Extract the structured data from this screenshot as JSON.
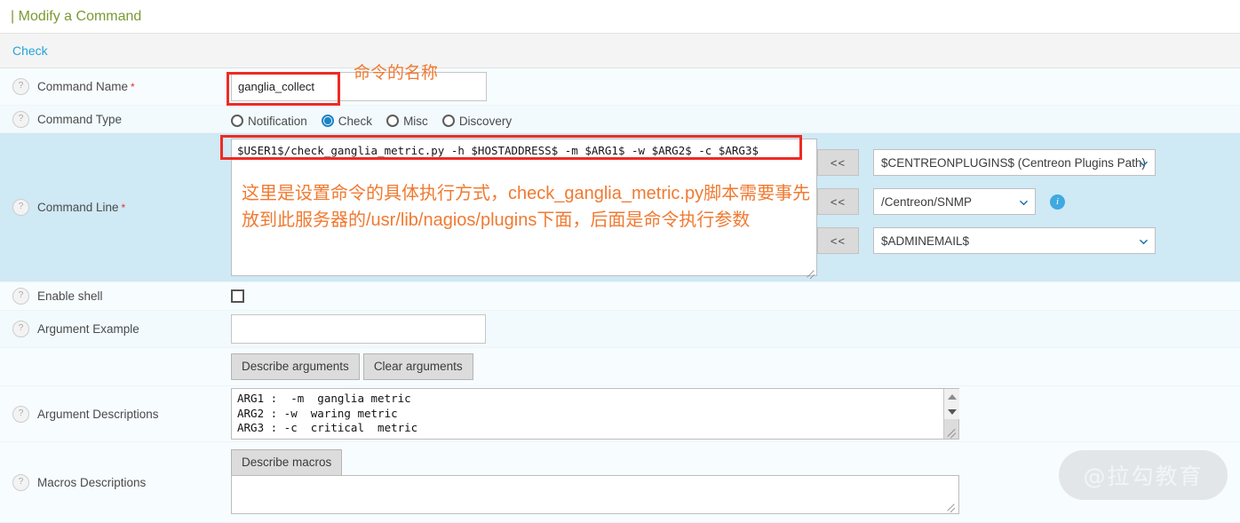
{
  "page": {
    "title_prefix": "|",
    "title": "Modify a Command",
    "section_tab": "Check",
    "watermark": "@拉勾教育"
  },
  "form": {
    "rows": {
      "command_name": {
        "label": "Command Name",
        "required_mark": "*",
        "value": "ganglia_collect",
        "help": "?"
      },
      "command_type": {
        "label": "Command Type",
        "help": "?",
        "options": [
          {
            "label": "Notification",
            "checked": false
          },
          {
            "label": "Check",
            "checked": true
          },
          {
            "label": "Misc",
            "checked": false
          },
          {
            "label": "Discovery",
            "checked": false
          }
        ]
      },
      "command_line": {
        "label": "Command Line",
        "required_mark": "*",
        "help": "?",
        "value": "$USER1$/check_ganglia_metric.py -h $HOSTADDRESS$ -m $ARG1$ -w $ARG2$ -c $ARG3$"
      },
      "enable_shell": {
        "label": "Enable shell",
        "help": "?",
        "checked": false
      },
      "argument_example": {
        "label": "Argument Example",
        "help": "?",
        "value": ""
      },
      "argument_buttons": {
        "describe": "Describe arguments",
        "clear": "Clear arguments"
      },
      "argument_descriptions": {
        "label": "Argument Descriptions",
        "help": "?",
        "value": "ARG1 :  -m  ganglia metric\nARG2 : -w  waring metric\nARG3 : -c  critical  metric"
      },
      "macros_descriptions": {
        "label": "Macros Descriptions",
        "help": "?",
        "describe_button": "Describe macros",
        "value": ""
      }
    },
    "macro_column": {
      "insert_button": "<<",
      "plugins_select": "$CENTREONPLUGINS$ (Centreon Plugins Path)",
      "snmp_select": "/Centreon/SNMP",
      "email_select": "$ADMINEMAIL$",
      "info_icon": "i"
    }
  },
  "annotations": {
    "command_name_note": "命令的名称",
    "command_line_note": "这里是设置命令的具体执行方式，check_ganglia_metric.py脚本需要事先放到此服务器的/usr/lib/nagios/plugins下面，后面是命令执行参数"
  },
  "colors": {
    "title_green": "#7a9a33",
    "tab_blue": "#25a4d8",
    "annotation_red": "#ee2b24",
    "annotation_orange": "#f07a31",
    "highlight_row": "#cfe9f5",
    "radio_accent": "#1c84c6"
  }
}
